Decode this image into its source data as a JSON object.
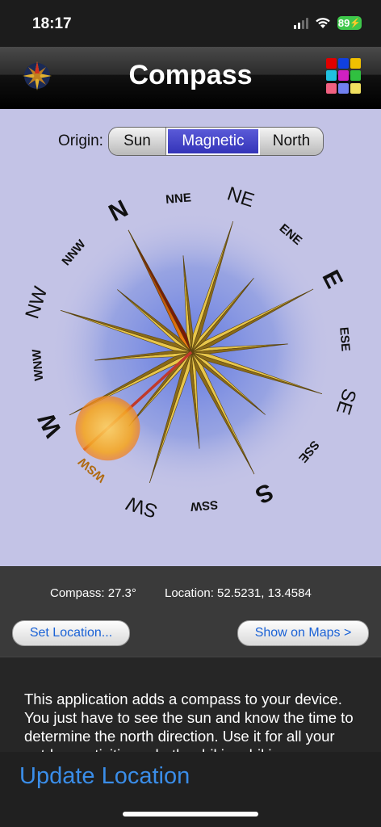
{
  "status": {
    "time": "18:17",
    "battery": "89"
  },
  "header": {
    "title": "Compass",
    "rose_icon": "compass-rose-icon",
    "grid_icon": "color-grid-icon",
    "grid_colors": [
      "#e00000",
      "#1040e0",
      "#f0c000",
      "#20c0e0",
      "#d020c0",
      "#30c040",
      "#f06080",
      "#7080f0",
      "#f0e060"
    ]
  },
  "origin": {
    "label": "Origin:",
    "options": [
      "Sun",
      "Magnetic",
      "North"
    ],
    "selected": "Magnetic"
  },
  "compass": {
    "directions": [
      "N",
      "NNE",
      "NE",
      "ENE",
      "E",
      "ESE",
      "SE",
      "SSE",
      "S",
      "SSW",
      "SW",
      "WSW",
      "W",
      "WNW",
      "NW",
      "NNW"
    ],
    "sun_label": "WSW",
    "colors": {
      "background": "#c3c3e6",
      "glow": "#5a73e0",
      "sun": "#f5a623",
      "needle_red": "#c0392b",
      "star": "#c9a227"
    }
  },
  "info": {
    "compass_reading": "Compass: 27.3°",
    "location_reading": "Location:  52.5231,  13.4584",
    "set_location": "Set Location...",
    "show_on_maps": "Show on Maps >"
  },
  "description": "This application adds a compass to your device. You just have to see the sun and know the time to determine the north direction. Use it for all your outdoor activities, whether hiking, hiking",
  "toolbar": {
    "update_location": "Update Location"
  }
}
